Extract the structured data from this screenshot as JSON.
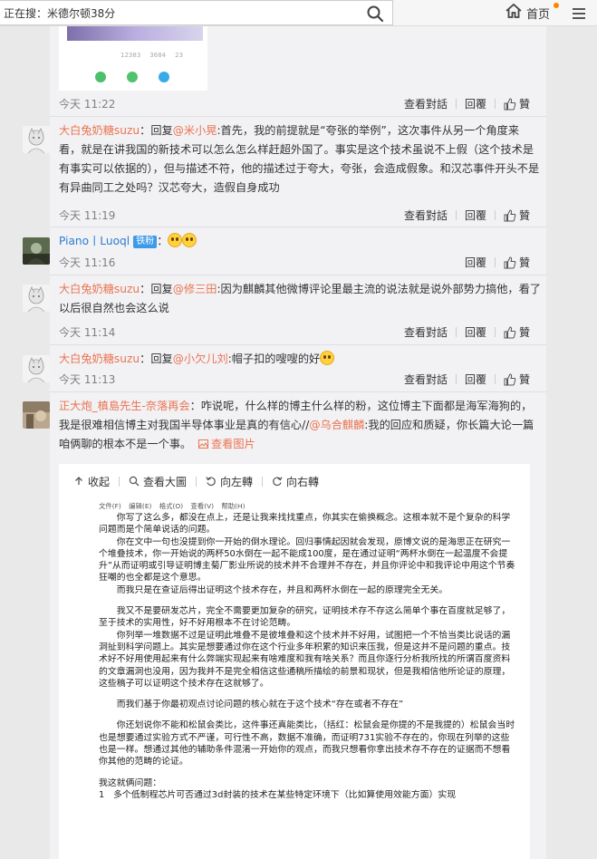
{
  "topbar": {
    "search_value": "正在搜：米德尔顿38分",
    "home_label": "首页",
    "search_icon": "search-icon",
    "home_icon": "home-icon",
    "menu_icon": "menu-icon"
  },
  "colors": {
    "accent": "#eb7350",
    "link_blue": "#2a7dcf",
    "badge": "#3d9ae8"
  },
  "action_labels": {
    "hide": "查看對話",
    "reply": "回覆",
    "like": "贊"
  },
  "top_item": {
    "image_share_labels": [
      "12383",
      "3684",
      "23"
    ],
    "time": "今天 11:22"
  },
  "comments": [
    {
      "user": "大白兔奶糖suzu",
      "reply_prefix": "：回复",
      "reply_to": "@米小晃",
      "body": ":首先，我的前提就是“夸张的举例”，这次事件从另一个角度来看，就是在讲我国的新技术可以怎么怎么样赶超外国了。事实是这个技术虽说不上假（这个技术是有事实可以依据的），但与描述不符，他的描述过于夸大，夸张，会造成假象。和汉芯事件开头不是有异曲同工之处吗？汉芯夸大，造假自身成功",
      "time": "今天 11:19"
    },
    {
      "user": "Piano丨Luoql",
      "badge": "铁粉",
      "time": "今天 11:16"
    },
    {
      "user": "大白兔奶糖suzu",
      "reply_prefix": "：回复",
      "reply_to": "@修三田",
      "body": ":因为麒麟其他微博评论里最主流的说法就是说外部势力搞他，看了以后很自然也会这么说",
      "time": "今天 11:14"
    },
    {
      "user": "大白兔奶糖suzu",
      "reply_prefix": "：回复",
      "reply_to": "@小欠儿刘",
      "body": ":帽子扣的嗖嗖的好",
      "time": "今天 11:13"
    },
    {
      "user": "正大炮_槙島先生-奈落再会",
      "body_a": "：咋说呢，什么样的博主什么样的粉，这位博主下面都是海军海狗的，我是很难相信博主对我国半导体事业是真的有信心//",
      "mention": "@乌合麒麟",
      "body_b": ":我的回应和质疑，你长篇大论一篇咱俩聊的根本不是一个事。",
      "view_image": "查看图片"
    }
  ],
  "viewer": {
    "collapse": "收起",
    "view_large": "查看大圖",
    "rotate_left": "向左轉",
    "rotate_right": "向右轉"
  },
  "document": {
    "menu": "文件(F) 编辑(E) 格式(O) 查看(V) 帮助(H)",
    "paragraphs": [
      "　　你写了这么多，都没在点上，还是让我来找找重点，你其实在偷换概念。这根本就不是个复杂的科学问题而是个简单说话的问题。",
      "　　你在文中一句也没提到你一开始的倒水理论。回归事情起因就会发现，原博文说的是海思正在研究一个堆叠技术，你一开始说的两杯50水倒在一起不能成100度，是在通过证明“两杯水倒在一起温度不会提升”从而证明或引导证明博主菊厂影业所说的技术并不合理并不存在，并且你评论中和我评论中用这个节奏狂嘲的也全都是这个意思。",
      "　　而我只是在查证后得出证明这个技术存在，并且和两杯水倒在一起的原理完全无关。",
      "",
      "　　我又不是要研发芯片，完全不需要更加复杂的研究，证明技术存不存这么简单个事在百度就足够了，至于技术的实用性，好不好用根本不在讨论范畴。",
      "　　你列举一堆数据不过是证明此堆叠不是彼堆叠和这个技术并不好用，试图把一个不恰当类比说话的漏洞扯到科学问题上。其实是想要通过你在这个行业多年积累的知识来压我，但是这并不是问题的重点。技术好不好用使用起来有什么弊端实现起来有啥难度和我有啥关系？而且你逐行分析我所找的所谓百度资料的文章漏洞也没用，因为我并不是完全相信这些通稿所描绘的前景和现状，但是我相信他所论证的原理，这些稿子可以证明这个技术存在这就够了。",
      "",
      "　　而我们基于你最初观点讨论问题的核心就在于这个技术“存在或者不存在”",
      "",
      "　　你还划说你不能和松鼠会类比，这件事还真能类比，（括红：松鼠会是你提的不是我提的）松鼠会当时也是想要通过实验方式不严谨，可行性不高，数据不准确，而证明731实验不存在的，你现在列举的这些也是一样。想通过其他的辅助条件混淆一开始你的观点，而我只想看你拿出技术存不存在的证据而不想看你其他的范畴的论证。",
      "",
      "我这就俩问题：",
      "1　多个低制程芯片可否通过3d封装的技术在某些特定环境下（比如算使用效能方面）实现"
    ]
  }
}
